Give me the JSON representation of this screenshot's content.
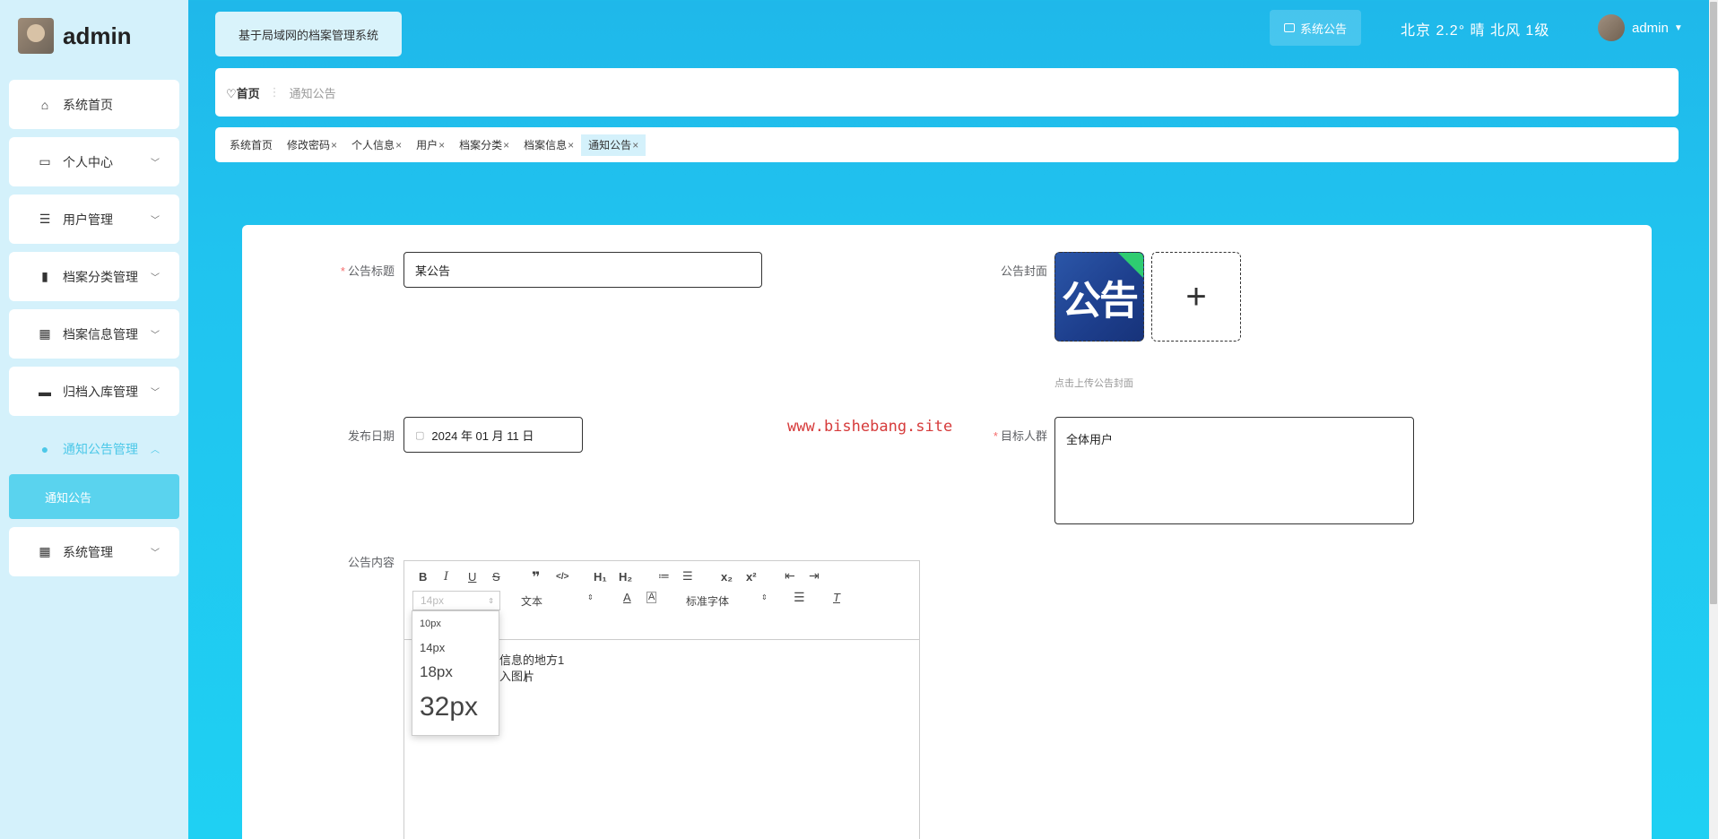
{
  "app": {
    "user": "admin"
  },
  "sidebar": {
    "items": [
      {
        "label": "系统首页",
        "icon": "home-icon",
        "glyph": "⌂",
        "chev": ""
      },
      {
        "label": "个人中心",
        "icon": "card-icon",
        "glyph": "▭",
        "chev": "﹀"
      },
      {
        "label": "用户管理",
        "icon": "list-icon",
        "glyph": "☰",
        "chev": "﹀"
      },
      {
        "label": "档案分类管理",
        "icon": "clipboard-icon",
        "glyph": "▮",
        "chev": "﹀"
      },
      {
        "label": "档案信息管理",
        "icon": "grid-icon",
        "glyph": "▦",
        "chev": "﹀"
      },
      {
        "label": "归档入库管理",
        "icon": "monitor-icon",
        "glyph": "▬",
        "chev": "﹀"
      },
      {
        "label": "通知公告管理",
        "icon": "bulb-icon",
        "glyph": "●",
        "chev": "︿"
      },
      {
        "label": "系统管理",
        "icon": "grid-icon",
        "glyph": "▦",
        "chev": "﹀"
      }
    ],
    "submenu_label": "通知公告"
  },
  "header": {
    "system_title": "基于局域网的档案管理系统",
    "notice_button": "系统公告",
    "weather": "北京 2.2° 晴 北风 1级",
    "username": "admin"
  },
  "breadcrumb": {
    "home": "首页",
    "current": "通知公告"
  },
  "tabs": [
    {
      "label": "系统首页",
      "closable": false
    },
    {
      "label": "修改密码",
      "closable": true
    },
    {
      "label": "个人信息",
      "closable": true
    },
    {
      "label": "用户",
      "closable": true
    },
    {
      "label": "档案分类",
      "closable": true
    },
    {
      "label": "档案信息",
      "closable": true
    },
    {
      "label": "通知公告",
      "closable": true
    }
  ],
  "form": {
    "title_label": "公告标题",
    "title_value": "某公告",
    "cover_label": "公告封面",
    "cover_image_text": "公告",
    "cover_hint": "点击上传公告封面",
    "date_label": "发布日期",
    "date_value": "2024 年 01 月 11 日",
    "target_label": "目标人群",
    "target_value": "全体用户",
    "content_label": "公告内容",
    "content_line1": "信息的地方1",
    "content_line2": "入图片"
  },
  "editor": {
    "row1": [
      "B",
      "I",
      "U",
      "S",
      "❞",
      "</>",
      "H₁",
      "H₂",
      "≔",
      "☰",
      "x₂",
      "x²",
      "⇤",
      "⇥"
    ],
    "size_selected": "14px",
    "header_selected": "文本",
    "font_selected": "标准字体",
    "size_options": [
      "10px",
      "14px",
      "18px",
      "32px"
    ]
  },
  "watermark": "www.bishebang.site",
  "colors": {
    "accent": "#4cc8e8",
    "required": "#f56c6c",
    "watermark": "#d63b3b"
  }
}
